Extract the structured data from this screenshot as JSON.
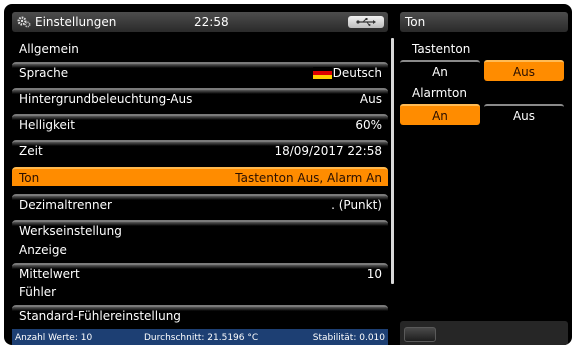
{
  "topbar": {
    "title": "Einstellungen",
    "time": "22:58",
    "icon": "gear-icon",
    "usb_icon": "usb-icon"
  },
  "menu": {
    "section_general": "Allgemein",
    "language": {
      "label": "Sprache",
      "value": "Deutsch",
      "flag": "germany-flag"
    },
    "backlight": {
      "label": "Hintergrundbeleuchtung-Aus",
      "value": "Aus"
    },
    "brightness": {
      "label": "Helligkeit",
      "value": "60%"
    },
    "time": {
      "label": "Zeit",
      "value": "18/09/2017 22:58"
    },
    "sound": {
      "label": "Ton",
      "value": "Tastenton Aus, Alarm An"
    },
    "decimal": {
      "label": "Dezimaltrenner",
      "value": ". (Punkt)"
    },
    "factory": {
      "label": "Werkseinstellung"
    },
    "section_display": "Anzeige",
    "average": {
      "label": "Mittelwert",
      "value": "10"
    },
    "section_sensor": "Fühler",
    "sensor_default": {
      "label": "Standard-Fühlereinstellung"
    }
  },
  "statusbar": {
    "count": "Anzahl Werte: 10",
    "average": "Durchschnitt: 21.5196 °C",
    "stability": "Stabilität: 0.010"
  },
  "right_panel": {
    "title": "Ton",
    "key_tone": {
      "label": "Tastenton",
      "on": "An",
      "off": "Aus",
      "selected": "Aus"
    },
    "alarm_tone": {
      "label": "Alarmton",
      "on": "An",
      "off": "Aus",
      "selected": "An"
    }
  },
  "colors": {
    "accent": "#ff8c00",
    "statusbar": "#1d3f73",
    "screen": "#000000"
  }
}
